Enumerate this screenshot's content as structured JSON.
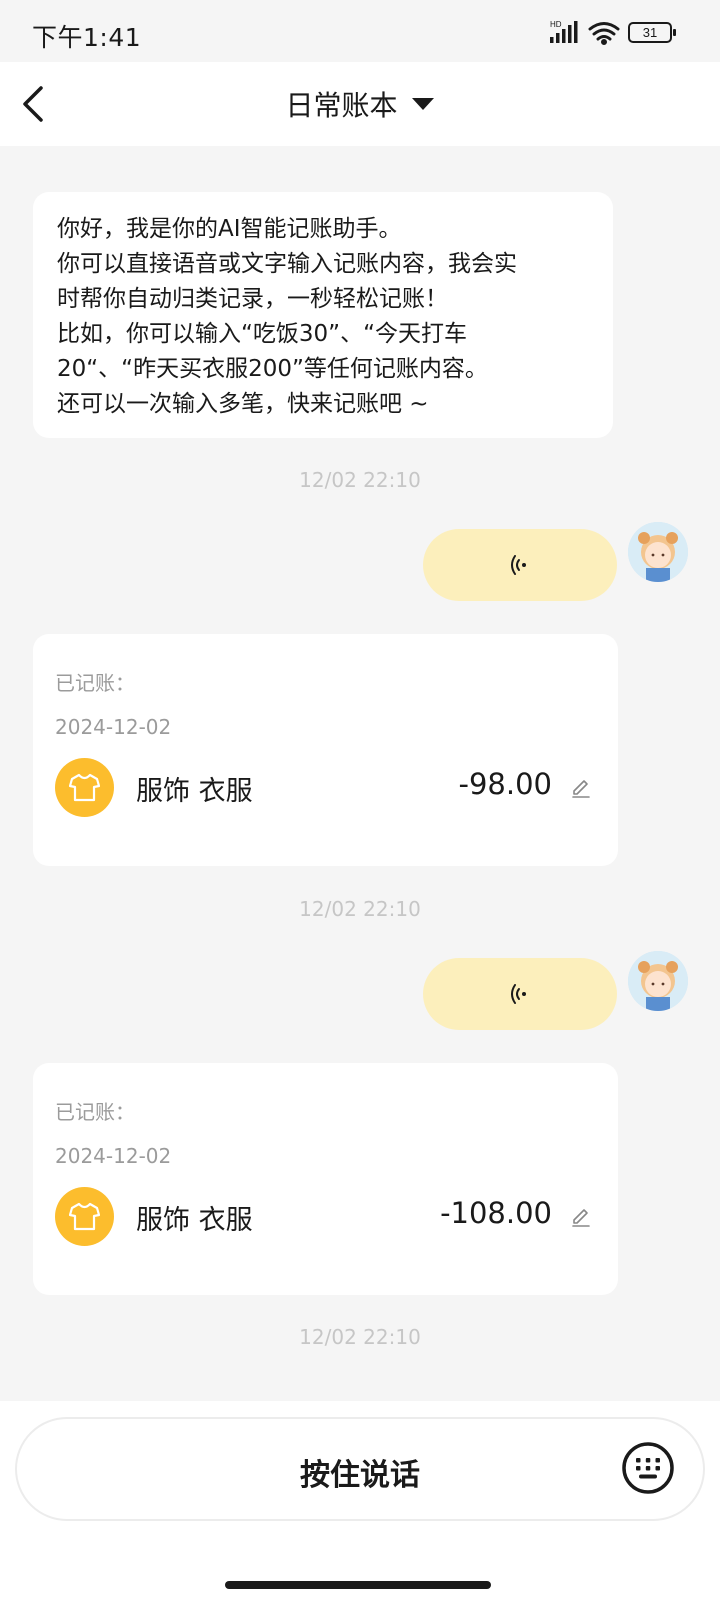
{
  "status_bar": {
    "time": "下午1:41",
    "network_label": "HD",
    "battery": "31",
    "icons": [
      "signal-icon",
      "wifi-icon",
      "battery-icon"
    ]
  },
  "header": {
    "title": "日常账本",
    "back_icon": "chevron-left-icon",
    "dropdown_icon": "caret-down-icon"
  },
  "colors": {
    "accent": "#fcbd2d",
    "voice_bubble": "#fcefbc",
    "background": "#f5f5f5",
    "timestamp": "#c6c6c6"
  },
  "chat": {
    "welcome": {
      "lines": [
        "你好，我是你的AI智能记账助手。",
        "你可以直接语音或文字输入记账内容，我会实",
        "时帮你自动归类记录，一秒轻松记账！",
        "比如，你可以输入“吃饭30”、“今天打车",
        "20“、“昨天买衣服200”等任何记账内容。",
        "还可以一次输入多笔，快来记账吧 ~"
      ]
    },
    "timestamps": [
      "12/02 22:10",
      "12/02 22:10",
      "12/02 22:10"
    ],
    "records": [
      {
        "label": "已记账：",
        "date": "2024-12-02",
        "category": "服饰 衣服",
        "amount": "-98.00",
        "icon": "tshirt-icon"
      },
      {
        "label": "已记账：",
        "date": "2024-12-02",
        "category": "服饰 衣服",
        "amount": "-108.00",
        "icon": "tshirt-icon"
      }
    ]
  },
  "bottom_bar": {
    "talk_label": "按住说话",
    "keyboard_icon": "keyboard-icon"
  }
}
